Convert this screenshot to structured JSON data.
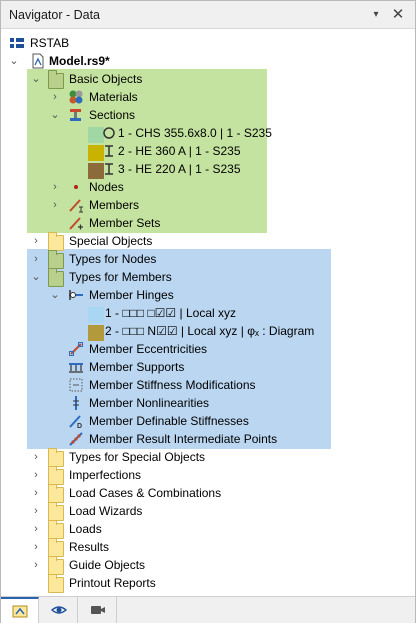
{
  "window": {
    "title": "Navigator - Data",
    "dropdown_glyph": "▾",
    "close_glyph": "✕"
  },
  "tree": {
    "root": "RSTAB",
    "model": "Model.rs9*",
    "basic_objects": "Basic Objects",
    "materials": "Materials",
    "sections": "Sections",
    "section_items": [
      {
        "label": "1 - CHS 355.6x8.0 | 1 - S235",
        "color": "#9fd8a4"
      },
      {
        "label": "2 - HE 360 A | 1 - S235",
        "color": "#c8b400"
      },
      {
        "label": "3 - HE 220 A | 1 - S235",
        "color": "#8c6a3a"
      }
    ],
    "nodes": "Nodes",
    "members": "Members",
    "member_sets": "Member Sets",
    "special_objects": "Special Objects",
    "types_for_nodes": "Types for Nodes",
    "types_for_members": "Types for Members",
    "member_hinges": "Member Hinges",
    "hinge_items": [
      {
        "label": "1 - □□□ □☑☑ | Local xyz",
        "color": "#a9d7f3"
      },
      {
        "label": "2 - □□□ N☑☑ | Local xyz | φₓ : Diagram",
        "color": "#b29a3c"
      }
    ],
    "member_types": [
      "Member Eccentricities",
      "Member Supports",
      "Member Stiffness Modifications",
      "Member Nonlinearities",
      "Member Definable Stiffnesses",
      "Member Result Intermediate Points"
    ],
    "other_folders": [
      "Types for Special Objects",
      "Imperfections",
      "Load Cases & Combinations",
      "Load Wizards",
      "Loads",
      "Results",
      "Guide Objects",
      "Printout Reports"
    ]
  },
  "colors": {
    "highlight_green": "#c5e3a0",
    "highlight_blue": "#bad6f0",
    "accent": "#2a64b0"
  },
  "icons": [
    "rstab-logo-icon",
    "model-file-icon",
    "folder-icon",
    "materials-icon",
    "sections-icon",
    "nodes-icon",
    "members-icon",
    "member-sets-icon",
    "member-hinge-icon",
    "data-tab-icon",
    "display-tab-icon",
    "views-tab-icon"
  ]
}
